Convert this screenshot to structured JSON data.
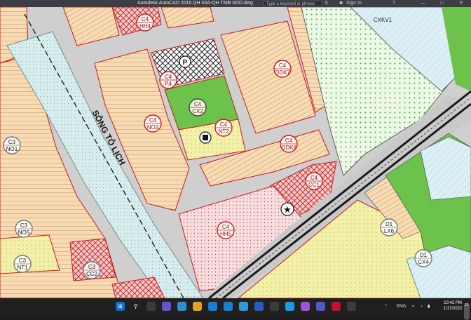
{
  "window": {
    "app_title": "Autodesk AutoCAD 2016",
    "file_title": "QH 04A-QH TMB SDD.dwg",
    "search_placeholder": "Type a keyword or phrase",
    "sign_in": "Sign In"
  },
  "map": {
    "river_label": "SÔNG TÔ LỊCH",
    "parcels": [
      {
        "code": "C4",
        "name": "HH4"
      },
      {
        "code": "C4",
        "name": "P4"
      },
      {
        "code": "C4",
        "name": "CX2"
      },
      {
        "code": "C4",
        "name": "NT2"
      },
      {
        "code": "C4",
        "name": "NO2"
      },
      {
        "code": "C4",
        "name": "ODK7"
      },
      {
        "code": "C4",
        "name": "ODK8"
      },
      {
        "code": "C4",
        "name": "CC1"
      },
      {
        "code": "C4",
        "name": "HH5"
      },
      {
        "code": "C3",
        "name": "NO1"
      },
      {
        "code": "C3",
        "name": "NO5"
      },
      {
        "code": "C3",
        "name": "NT1"
      },
      {
        "code": "C3",
        "name": "CC2"
      },
      {
        "code": "D1",
        "name": "LX6"
      },
      {
        "code": "D1",
        "name": "CX4"
      },
      {
        "code": "",
        "name": "CXKV1"
      }
    ],
    "parking_symbol": "P",
    "colors": {
      "residential": "#f6dcb4",
      "green": "#6cc24a",
      "light_green": "#d8f0c8",
      "public": "#f5c8c8",
      "school": "#f3f09a",
      "river": "#cfe6e6",
      "road": "#bdbdbd",
      "boundary": "#d01818"
    }
  },
  "taskbar": {
    "language": "ENG",
    "time": "10:42 PM",
    "date": "1/17/2022",
    "notification_count": "13"
  }
}
